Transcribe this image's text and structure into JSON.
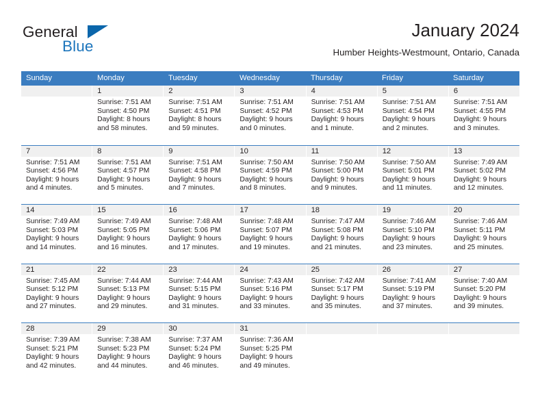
{
  "brand": {
    "word1": "General",
    "word2": "Blue",
    "triangle_color": "#0b66ab",
    "blue_color": "#1c75bc"
  },
  "header": {
    "title": "January 2024",
    "subtitle": "Humber Heights-Westmount, Ontario, Canada"
  },
  "theme": {
    "header_bg": "#3b7dc0",
    "daynum_bg": "#f0f0f0",
    "text": "#231f20"
  },
  "weekdays": [
    "Sunday",
    "Monday",
    "Tuesday",
    "Wednesday",
    "Thursday",
    "Friday",
    "Saturday"
  ],
  "weeks": [
    [
      {
        "day": "",
        "lines": []
      },
      {
        "day": "1",
        "lines": [
          "Sunrise: 7:51 AM",
          "Sunset: 4:50 PM",
          "Daylight: 8 hours",
          "and 58 minutes."
        ]
      },
      {
        "day": "2",
        "lines": [
          "Sunrise: 7:51 AM",
          "Sunset: 4:51 PM",
          "Daylight: 8 hours",
          "and 59 minutes."
        ]
      },
      {
        "day": "3",
        "lines": [
          "Sunrise: 7:51 AM",
          "Sunset: 4:52 PM",
          "Daylight: 9 hours",
          "and 0 minutes."
        ]
      },
      {
        "day": "4",
        "lines": [
          "Sunrise: 7:51 AM",
          "Sunset: 4:53 PM",
          "Daylight: 9 hours",
          "and 1 minute."
        ]
      },
      {
        "day": "5",
        "lines": [
          "Sunrise: 7:51 AM",
          "Sunset: 4:54 PM",
          "Daylight: 9 hours",
          "and 2 minutes."
        ]
      },
      {
        "day": "6",
        "lines": [
          "Sunrise: 7:51 AM",
          "Sunset: 4:55 PM",
          "Daylight: 9 hours",
          "and 3 minutes."
        ]
      }
    ],
    [
      {
        "day": "7",
        "lines": [
          "Sunrise: 7:51 AM",
          "Sunset: 4:56 PM",
          "Daylight: 9 hours",
          "and 4 minutes."
        ]
      },
      {
        "day": "8",
        "lines": [
          "Sunrise: 7:51 AM",
          "Sunset: 4:57 PM",
          "Daylight: 9 hours",
          "and 5 minutes."
        ]
      },
      {
        "day": "9",
        "lines": [
          "Sunrise: 7:51 AM",
          "Sunset: 4:58 PM",
          "Daylight: 9 hours",
          "and 7 minutes."
        ]
      },
      {
        "day": "10",
        "lines": [
          "Sunrise: 7:50 AM",
          "Sunset: 4:59 PM",
          "Daylight: 9 hours",
          "and 8 minutes."
        ]
      },
      {
        "day": "11",
        "lines": [
          "Sunrise: 7:50 AM",
          "Sunset: 5:00 PM",
          "Daylight: 9 hours",
          "and 9 minutes."
        ]
      },
      {
        "day": "12",
        "lines": [
          "Sunrise: 7:50 AM",
          "Sunset: 5:01 PM",
          "Daylight: 9 hours",
          "and 11 minutes."
        ]
      },
      {
        "day": "13",
        "lines": [
          "Sunrise: 7:49 AM",
          "Sunset: 5:02 PM",
          "Daylight: 9 hours",
          "and 12 minutes."
        ]
      }
    ],
    [
      {
        "day": "14",
        "lines": [
          "Sunrise: 7:49 AM",
          "Sunset: 5:03 PM",
          "Daylight: 9 hours",
          "and 14 minutes."
        ]
      },
      {
        "day": "15",
        "lines": [
          "Sunrise: 7:49 AM",
          "Sunset: 5:05 PM",
          "Daylight: 9 hours",
          "and 16 minutes."
        ]
      },
      {
        "day": "16",
        "lines": [
          "Sunrise: 7:48 AM",
          "Sunset: 5:06 PM",
          "Daylight: 9 hours",
          "and 17 minutes."
        ]
      },
      {
        "day": "17",
        "lines": [
          "Sunrise: 7:48 AM",
          "Sunset: 5:07 PM",
          "Daylight: 9 hours",
          "and 19 minutes."
        ]
      },
      {
        "day": "18",
        "lines": [
          "Sunrise: 7:47 AM",
          "Sunset: 5:08 PM",
          "Daylight: 9 hours",
          "and 21 minutes."
        ]
      },
      {
        "day": "19",
        "lines": [
          "Sunrise: 7:46 AM",
          "Sunset: 5:10 PM",
          "Daylight: 9 hours",
          "and 23 minutes."
        ]
      },
      {
        "day": "20",
        "lines": [
          "Sunrise: 7:46 AM",
          "Sunset: 5:11 PM",
          "Daylight: 9 hours",
          "and 25 minutes."
        ]
      }
    ],
    [
      {
        "day": "21",
        "lines": [
          "Sunrise: 7:45 AM",
          "Sunset: 5:12 PM",
          "Daylight: 9 hours",
          "and 27 minutes."
        ]
      },
      {
        "day": "22",
        "lines": [
          "Sunrise: 7:44 AM",
          "Sunset: 5:13 PM",
          "Daylight: 9 hours",
          "and 29 minutes."
        ]
      },
      {
        "day": "23",
        "lines": [
          "Sunrise: 7:44 AM",
          "Sunset: 5:15 PM",
          "Daylight: 9 hours",
          "and 31 minutes."
        ]
      },
      {
        "day": "24",
        "lines": [
          "Sunrise: 7:43 AM",
          "Sunset: 5:16 PM",
          "Daylight: 9 hours",
          "and 33 minutes."
        ]
      },
      {
        "day": "25",
        "lines": [
          "Sunrise: 7:42 AM",
          "Sunset: 5:17 PM",
          "Daylight: 9 hours",
          "and 35 minutes."
        ]
      },
      {
        "day": "26",
        "lines": [
          "Sunrise: 7:41 AM",
          "Sunset: 5:19 PM",
          "Daylight: 9 hours",
          "and 37 minutes."
        ]
      },
      {
        "day": "27",
        "lines": [
          "Sunrise: 7:40 AM",
          "Sunset: 5:20 PM",
          "Daylight: 9 hours",
          "and 39 minutes."
        ]
      }
    ],
    [
      {
        "day": "28",
        "lines": [
          "Sunrise: 7:39 AM",
          "Sunset: 5:21 PM",
          "Daylight: 9 hours",
          "and 42 minutes."
        ]
      },
      {
        "day": "29",
        "lines": [
          "Sunrise: 7:38 AM",
          "Sunset: 5:23 PM",
          "Daylight: 9 hours",
          "and 44 minutes."
        ]
      },
      {
        "day": "30",
        "lines": [
          "Sunrise: 7:37 AM",
          "Sunset: 5:24 PM",
          "Daylight: 9 hours",
          "and 46 minutes."
        ]
      },
      {
        "day": "31",
        "lines": [
          "Sunrise: 7:36 AM",
          "Sunset: 5:25 PM",
          "Daylight: 9 hours",
          "and 49 minutes."
        ]
      },
      {
        "day": "",
        "lines": []
      },
      {
        "day": "",
        "lines": []
      },
      {
        "day": "",
        "lines": []
      }
    ]
  ]
}
